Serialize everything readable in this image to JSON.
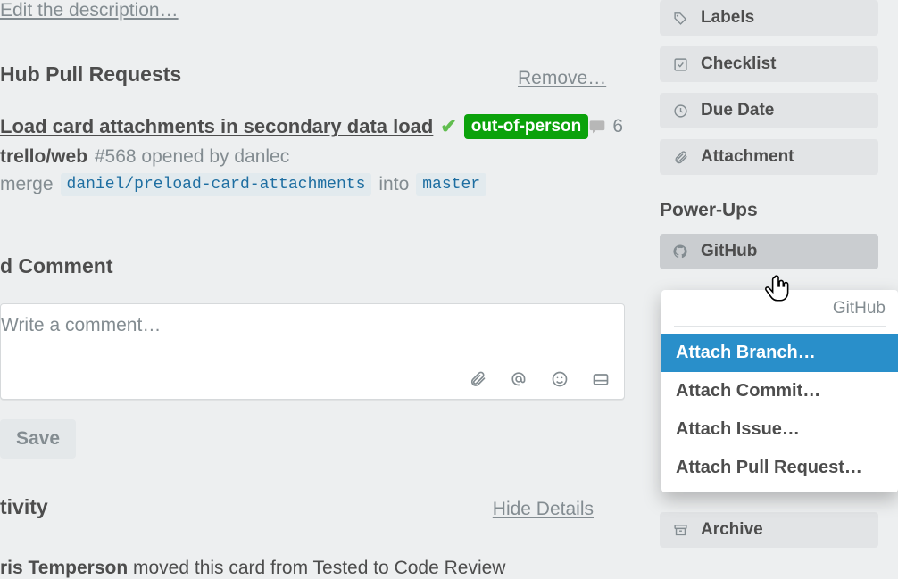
{
  "description": {
    "edit_link": "Edit the description…"
  },
  "pull_requests": {
    "section_title": "Hub Pull Requests",
    "remove_label": "Remove…",
    "item": {
      "title": "Load card attachments in secondary data load",
      "badge": "out-of-person",
      "comment_count": "6",
      "repo": "trello/web",
      "meta_rest": " #568 opened by danlec",
      "merge_word": "merge",
      "source_branch": "daniel/preload-card-attachments",
      "into_word": "into",
      "target_branch": "master"
    }
  },
  "comment": {
    "section_title": "d Comment",
    "placeholder": "Write a comment…",
    "save_label": "Save"
  },
  "activity": {
    "section_title": "tivity",
    "hide_label": "Hide Details",
    "entry_actor": "ris Temperson",
    "entry_rest": " moved this card from Tested to Code Review"
  },
  "sidebar": {
    "labels": "Labels",
    "checklist": "Checklist",
    "due_date": "Due Date",
    "attachment": "Attachment",
    "powerups_heading": "Power-Ups",
    "github": "GitHub",
    "archive": "Archive"
  },
  "popup": {
    "title": "GitHub",
    "items": [
      "Attach Branch…",
      "Attach Commit…",
      "Attach Issue…",
      "Attach Pull Request…"
    ],
    "selected_index": 0
  }
}
